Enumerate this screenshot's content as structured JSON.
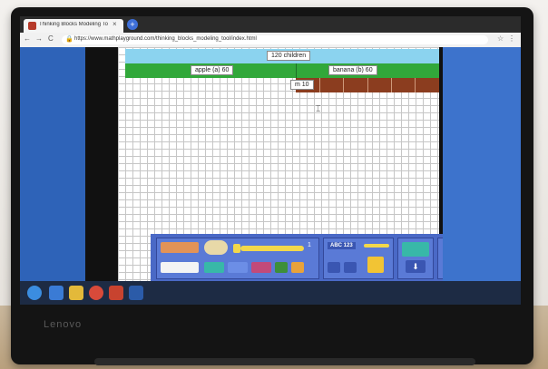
{
  "browser": {
    "tab_title": "Thinking Blocks Modeling Tool",
    "tab_close": "×",
    "new_tab": "+",
    "back": "←",
    "forward": "→",
    "reload": "C",
    "lock": "🔒",
    "url": "https://www.mathplayground.com/thinking_blocks_modeling_tool/index.html",
    "bookmark": "☆",
    "account": "⋮"
  },
  "model": {
    "total_label": "120 children",
    "apple_label": "apple (a) 60",
    "banana_label": "banana (b) 60",
    "m_label": "m 10"
  },
  "toolbar": {
    "slider_value": "1",
    "abc_label": "ABC 123"
  },
  "device": {
    "brand": "Lenovo"
  },
  "colors": {
    "total_bar": "#8bd3ef",
    "green_bar": "#31a83a",
    "brown_bar": "#8b3d1f",
    "toolbar": "#4a69c6",
    "page_bg": "#2e63b8"
  }
}
